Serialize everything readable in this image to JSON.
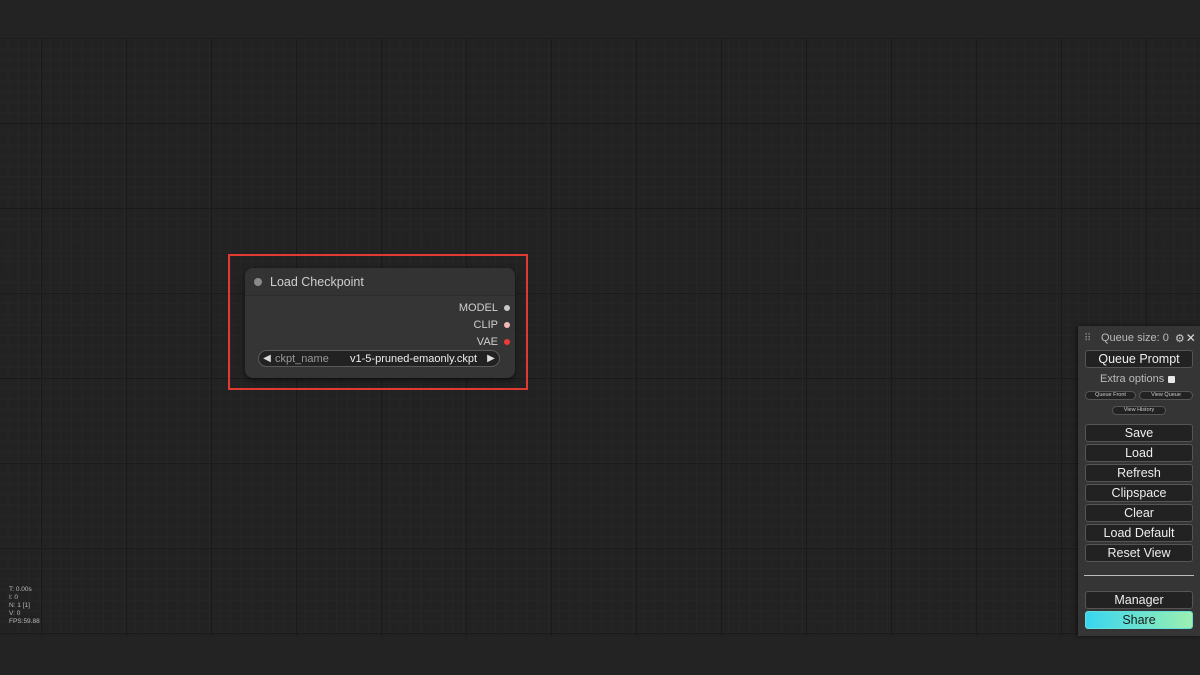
{
  "node": {
    "title": "Load Checkpoint",
    "outputs": [
      {
        "label": "MODEL",
        "color": "#c8c8c8"
      },
      {
        "label": "CLIP",
        "color": "#f3b8b8"
      },
      {
        "label": "VAE",
        "color": "#f03a3a"
      }
    ],
    "widget": {
      "name": "ckpt_name",
      "value": "v1-5-pruned-emaonly.ckpt",
      "left_arrow": "◀",
      "right_arrow": "▶"
    }
  },
  "stats": {
    "t": "T: 0.00s",
    "i": "I: 0",
    "n": "N: 1 [1]",
    "v": "V: 0",
    "fps": "FPS:59.88"
  },
  "menu": {
    "queue_size": "Queue size: 0",
    "gear_icon": "⚙",
    "close_icon": "✕",
    "queue_prompt": "Queue Prompt",
    "extra_options": "Extra options",
    "queue_front": "Queue Front",
    "view_queue": "View Queue",
    "view_history": "View History",
    "save": "Save",
    "load": "Load",
    "refresh": "Refresh",
    "clipspace": "Clipspace",
    "clear": "Clear",
    "load_default": "Load Default",
    "reset_view": "Reset View",
    "manager": "Manager",
    "share": "Share"
  },
  "colors": {
    "highlight": "#e03a32",
    "share_gradient_start": "#38d6f0",
    "share_gradient_end": "#9bf0b0"
  }
}
